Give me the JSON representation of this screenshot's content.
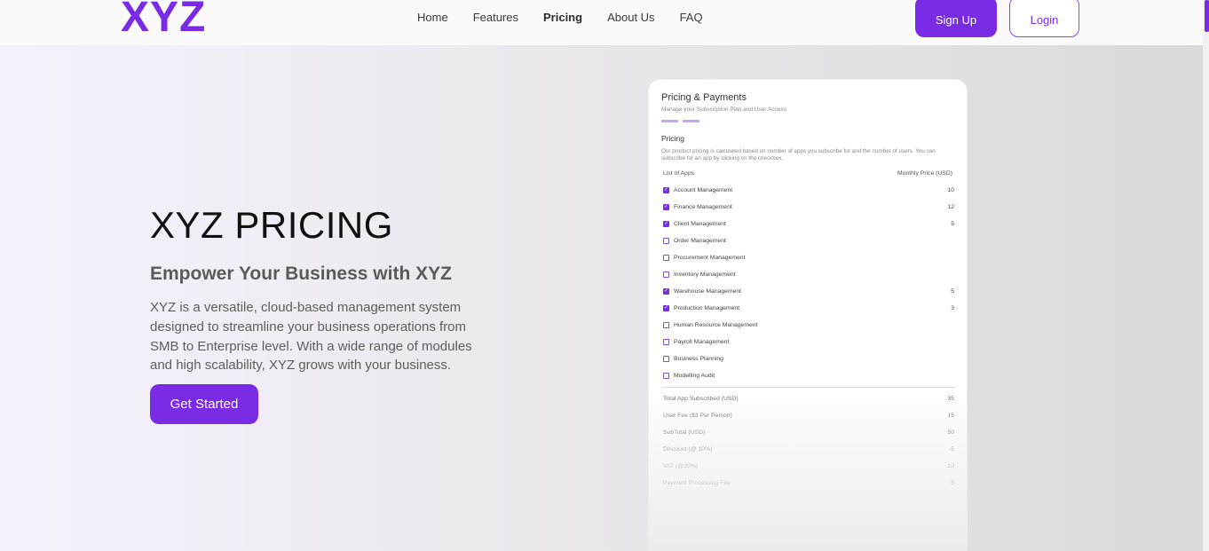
{
  "header": {
    "logo": "XYZ",
    "nav": [
      "Home",
      "Features",
      "Pricing",
      "About Us",
      "FAQ"
    ],
    "active_nav": "Pricing",
    "signup_label": "Sign Up",
    "login_label": "Login"
  },
  "hero": {
    "title": "XYZ PRICING",
    "subtitle": "Empower Your Business with XYZ",
    "description": "XYZ is a versatile, cloud-based management system designed to streamline your business operations from SMB to Enterprise level. With a wide range of modules and high scalability, XYZ grows with your business.",
    "cta_label": "Get Started"
  },
  "card": {
    "title": "Pricing & Payments",
    "subtitle": "Manage your Subscription Plan and User Access",
    "section_title": "Pricing",
    "section_desc": "Our product pricing is calculated based on number of apps you subscribe for and the number of users. You can subscribe for an app by clicking on the checkbox.",
    "col_apps": "List of Apps",
    "col_price": "Monthly Price (USD)",
    "apps": [
      {
        "name": "Account Management",
        "checked": true,
        "price": "10"
      },
      {
        "name": "Finance Management",
        "checked": true,
        "price": "12"
      },
      {
        "name": "Client Management",
        "checked": true,
        "price": "5"
      },
      {
        "name": "Order Management",
        "checked": false,
        "price": ""
      },
      {
        "name": "Procurement Management",
        "checked": false,
        "price": ""
      },
      {
        "name": "Inventory Management",
        "checked": false,
        "price": ""
      },
      {
        "name": "Warehouse Management",
        "checked": true,
        "price": "5"
      },
      {
        "name": "Production Management",
        "checked": true,
        "price": "3"
      },
      {
        "name": "Human Resource Management",
        "checked": false,
        "price": ""
      },
      {
        "name": "Payroll Management",
        "checked": false,
        "price": ""
      },
      {
        "name": "Business Planning",
        "checked": false,
        "price": ""
      },
      {
        "name": "Modelling Audit",
        "checked": false,
        "price": ""
      }
    ],
    "summary": [
      {
        "label": "Total App Subscribed (USD)",
        "value": "35"
      },
      {
        "label": "User Fee ($3 Per Person)",
        "value": "15"
      },
      {
        "label": "SubTotal (USD)",
        "value": "50"
      },
      {
        "label": "Discount (@ 10%)",
        "value": "-5"
      },
      {
        "label": "VAT (@20%)",
        "value": "10"
      },
      {
        "label": "Payment Processing Fee",
        "value": "5"
      }
    ]
  },
  "colors": {
    "accent": "#7a2be6",
    "checkbox_accent": "#8a4ae8",
    "tab_bar": "#c6a3f2"
  }
}
